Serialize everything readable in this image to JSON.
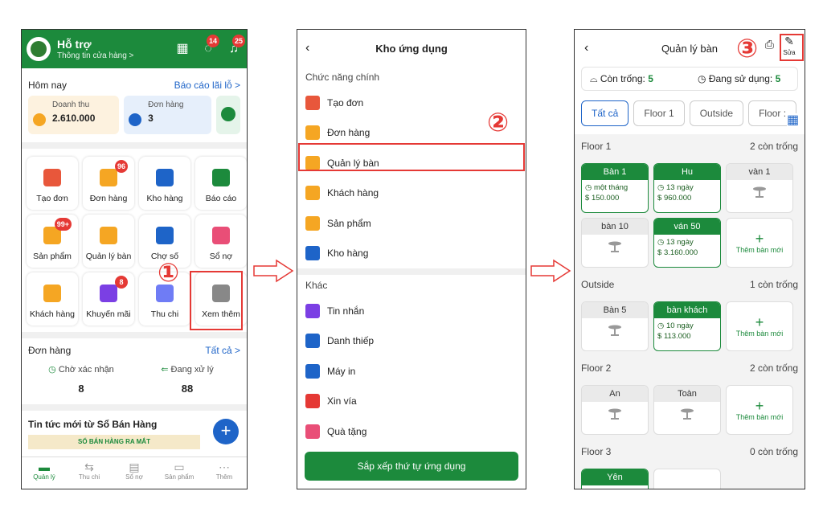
{
  "phone1": {
    "header": {
      "title": "Hỗ trợ",
      "subtitle": "Thông tin cửa hàng >",
      "badge_msg": "14",
      "badge_bell": "25"
    },
    "today": {
      "label": "Hôm nay",
      "report_link": "Báo cáo lãi lỗ >",
      "revenue_label": "Doanh thu",
      "revenue_value": "2.610.000",
      "orders_label": "Đơn hàng",
      "orders_value": "3"
    },
    "tiles": [
      {
        "label": "Tạo đơn",
        "badge": "",
        "color": "#e8573b"
      },
      {
        "label": "Đơn hàng",
        "badge": "96",
        "color": "#f5a623"
      },
      {
        "label": "Kho hàng",
        "badge": "",
        "color": "#1e64c8"
      },
      {
        "label": "Báo cáo",
        "badge": "",
        "color": "#1c8a3c"
      },
      {
        "label": "Sản phẩm",
        "badge": "99+",
        "color": "#f5a623"
      },
      {
        "label": "Quản lý bàn",
        "badge": "",
        "color": "#f5a623"
      },
      {
        "label": "Chợ số",
        "badge": "",
        "color": "#1e64c8"
      },
      {
        "label": "Sổ nợ",
        "badge": "",
        "color": "#e94e77"
      },
      {
        "label": "Khách hàng",
        "badge": "",
        "color": "#f5a623"
      },
      {
        "label": "Khuyến mãi",
        "badge": "8",
        "color": "#7b3fe4"
      },
      {
        "label": "Thu chi",
        "badge": "",
        "color": "#6f7cf5"
      },
      {
        "label": "Xem thêm",
        "badge": "",
        "color": "#888888"
      }
    ],
    "orders": {
      "title": "Đơn hàng",
      "all_link": "Tất cả >",
      "pending_label": "Chờ xác nhận",
      "pending_value": "8",
      "processing_label": "Đang xử lý",
      "processing_value": "88"
    },
    "news": {
      "title": "Tin tức mới từ Sổ Bán Hàng",
      "banner": "SỔ BÁN HÀNG RA MẮT"
    },
    "nav": [
      "Quản lý",
      "Thu chi",
      "Sổ nợ",
      "Sản phẩm",
      "Thêm"
    ],
    "step": "①"
  },
  "phone2": {
    "title": "Kho ứng dụng",
    "group1": "Chức năng chính",
    "apps1": [
      {
        "label": "Tạo đơn",
        "color": "#e8573b"
      },
      {
        "label": "Đơn hàng",
        "color": "#f5a623"
      },
      {
        "label": "Quản lý bàn",
        "color": "#f5a623"
      },
      {
        "label": "Khách hàng",
        "color": "#f5a623"
      },
      {
        "label": "Sản phẩm",
        "color": "#f5a623"
      },
      {
        "label": "Kho hàng",
        "color": "#1e64c8"
      }
    ],
    "group2": "Khác",
    "apps2": [
      {
        "label": "Tin nhắn",
        "color": "#7b3fe4"
      },
      {
        "label": "Danh thiếp",
        "color": "#1e64c8"
      },
      {
        "label": "Máy in",
        "color": "#1e64c8"
      },
      {
        "label": "Xin vía",
        "color": "#e53935"
      },
      {
        "label": "Quà tặng",
        "color": "#e94e77"
      }
    ],
    "sort_button": "Sắp xếp thứ tự ứng dụng",
    "step": "②"
  },
  "phone3": {
    "title": "Quản lý bàn",
    "edit_label": "Sửa",
    "stats": {
      "free_label": "Còn trống:",
      "free_value": "5",
      "busy_label": "Đang sử dụng:",
      "busy_value": "5"
    },
    "tabs": [
      "Tất cả",
      "Floor 1",
      "Outside",
      "Floor :"
    ],
    "floors": [
      {
        "name": "Floor 1",
        "free": "2 còn trống",
        "tables": [
          {
            "name": "Bàn 1",
            "busy": true,
            "time": "một tháng",
            "amount": "150.000"
          },
          {
            "name": "Hu",
            "busy": true,
            "time": "13 ngày",
            "amount": "960.000"
          },
          {
            "name": "vàn 1",
            "busy": false
          },
          {
            "name": "bàn 10",
            "busy": false
          },
          {
            "name": "ván 50",
            "busy": true,
            "time": "13 ngày",
            "amount": "3.160.000"
          }
        ]
      },
      {
        "name": "Outside",
        "free": "1 còn trống",
        "tables": [
          {
            "name": "Bàn 5",
            "busy": false
          },
          {
            "name": "bàn khách",
            "busy": true,
            "time": "10 ngày",
            "amount": "113.000"
          }
        ]
      },
      {
        "name": "Floor 2",
        "free": "2 còn trống",
        "tables": [
          {
            "name": "An",
            "busy": false
          },
          {
            "name": "Toàn",
            "busy": false
          }
        ]
      },
      {
        "name": "Floor 3",
        "free": "0 còn trống",
        "tables": [
          {
            "name": "Yên",
            "busy": true
          }
        ]
      }
    ],
    "add_table": "Thêm bàn mới",
    "step": "③"
  }
}
